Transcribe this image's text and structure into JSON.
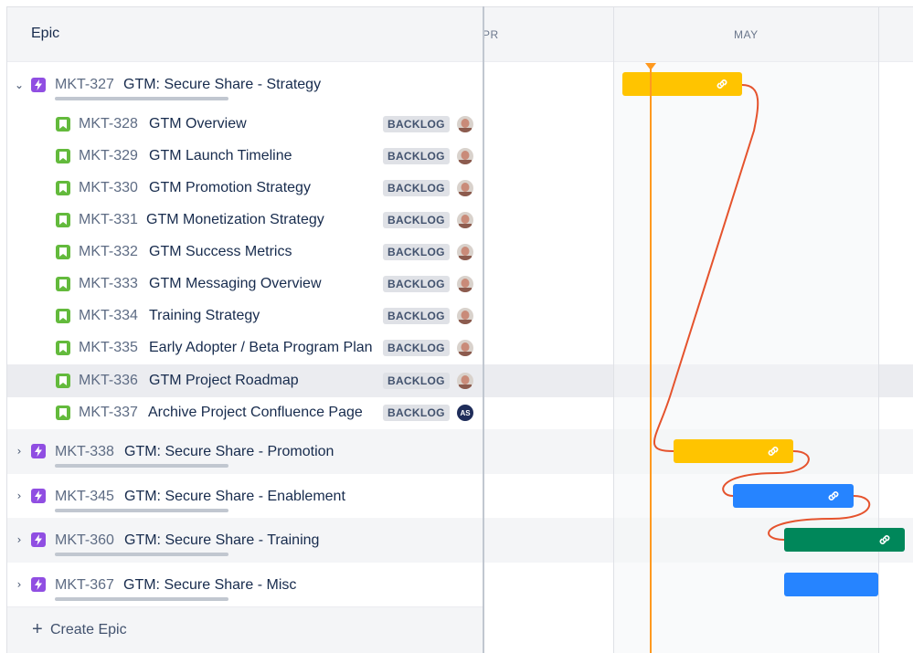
{
  "left_panel": {
    "header_title": "Epic",
    "create_label": "Create Epic"
  },
  "timeline": {
    "months": [
      "PR",
      "MAY"
    ]
  },
  "epics": [
    {
      "key": "MKT-327",
      "title": "GTM: Secure Share - Strategy",
      "expanded": true,
      "children": [
        {
          "key": "MKT-328",
          "title": "GTM Overview",
          "status": "BACKLOG",
          "avatar": "photo"
        },
        {
          "key": "MKT-329",
          "title": "GTM Launch Timeline",
          "status": "BACKLOG",
          "avatar": "photo"
        },
        {
          "key": "MKT-330",
          "title": "GTM Promotion Strategy",
          "status": "BACKLOG",
          "avatar": "photo"
        },
        {
          "key": "MKT-331",
          "title": "GTM Monetization Strategy",
          "status": "BACKLOG",
          "avatar": "photo"
        },
        {
          "key": "MKT-332",
          "title": "GTM Success Metrics",
          "status": "BACKLOG",
          "avatar": "photo"
        },
        {
          "key": "MKT-333",
          "title": "GTM Messaging Overview",
          "status": "BACKLOG",
          "avatar": "photo"
        },
        {
          "key": "MKT-334",
          "title": "Training Strategy",
          "status": "BACKLOG",
          "avatar": "photo"
        },
        {
          "key": "MKT-335",
          "title": "Early Adopter / Beta Program Plan",
          "status": "BACKLOG",
          "avatar": "photo"
        },
        {
          "key": "MKT-336",
          "title": "GTM Project Roadmap",
          "status": "BACKLOG",
          "avatar": "photo"
        },
        {
          "key": "MKT-337",
          "title": "Archive Project Confluence Page",
          "status": "BACKLOG",
          "avatar": "AS"
        }
      ]
    },
    {
      "key": "MKT-338",
      "title": "GTM: Secure Share - Promotion",
      "expanded": false
    },
    {
      "key": "MKT-345",
      "title": "GTM: Secure Share - Enablement",
      "expanded": false
    },
    {
      "key": "MKT-360",
      "title": "GTM: Secure Share - Training",
      "expanded": false
    },
    {
      "key": "MKT-367",
      "title": "GTM: Secure Share - Misc",
      "expanded": false
    }
  ],
  "colors": {
    "epic_icon": "#904ee2",
    "story_icon": "#63ba3c",
    "bar_yellow": "#ffc400",
    "bar_blue": "#2684ff",
    "bar_green": "#00875a",
    "dependency_line": "#e5532d",
    "today_line": "#ff991f"
  },
  "icons": {
    "expand_open": "chevron-down-icon",
    "expand_closed": "chevron-right-icon",
    "epic": "lightning-icon",
    "story": "bookmark-icon",
    "bar_link": "link-icon",
    "create": "plus-icon"
  }
}
